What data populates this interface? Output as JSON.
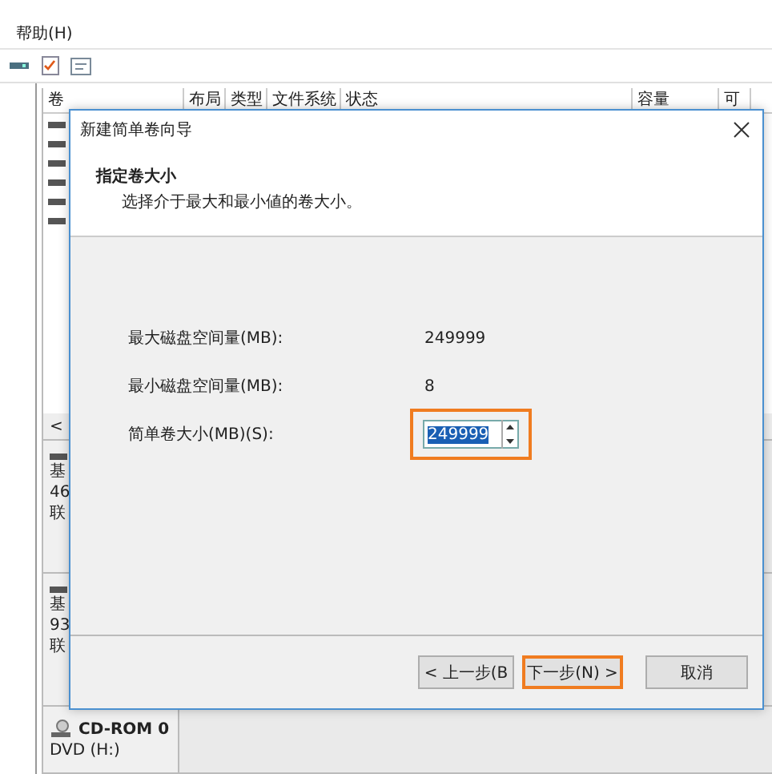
{
  "menu": [
    "帮助(H)"
  ],
  "table": {
    "columns": [
      "卷",
      "布局",
      "类型",
      "文件系统",
      "状态",
      "容量",
      "可"
    ],
    "rows": [
      {
        "kind": "volume"
      },
      {
        "kind": "volume"
      },
      {
        "kind": "volume"
      },
      {
        "kind": "volume"
      },
      {
        "kind": "volume"
      },
      {
        "kind": "volume"
      }
    ],
    "scroll_left": "<"
  },
  "disks": [
    {
      "kind": "disk",
      "lines": [
        "基",
        "46",
        "联"
      ]
    },
    {
      "kind": "disk",
      "lines": [
        "基",
        "93",
        "联"
      ]
    },
    {
      "kind": "cdrom",
      "name": "CD-ROM 0",
      "lines": [
        "DVD (H:)"
      ]
    }
  ],
  "dialog": {
    "title": "新建简单卷向导",
    "heading": "指定卷大小",
    "subheading": "选择介于最大和最小値的卷大小。",
    "fields": [
      {
        "kind": "readonly",
        "label": "最大磁盘空间量(MB):",
        "value": "249999"
      },
      {
        "kind": "readonly",
        "label": "最小磁盘空间量(MB):",
        "value": "8"
      },
      {
        "kind": "spin",
        "label": "简单卷大小(MB)(S):",
        "value": "249999",
        "highlighted": true
      }
    ],
    "buttons": [
      {
        "label": "< 上一步(B",
        "highlighted": false
      },
      {
        "label": "下一步(N) >",
        "highlighted": true
      },
      {
        "label": "取消",
        "highlighted": false
      }
    ]
  }
}
